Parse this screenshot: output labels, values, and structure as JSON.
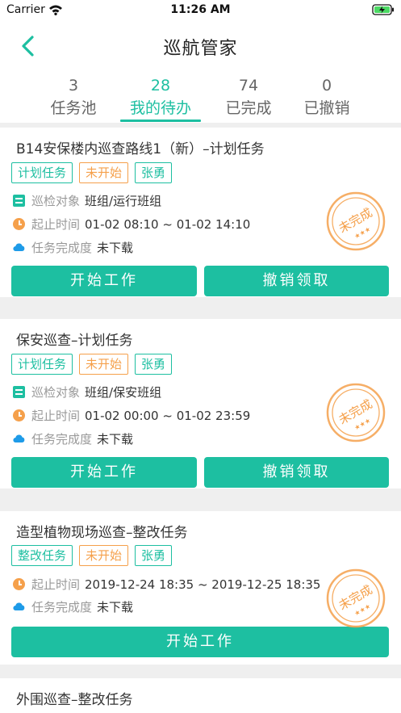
{
  "status": {
    "carrier": "Carrier",
    "time": "11:26 AM"
  },
  "nav": {
    "title": "巡航管家"
  },
  "tabs": [
    {
      "count": "3",
      "label": "任务池"
    },
    {
      "count": "28",
      "label": "我的待办"
    },
    {
      "count": "74",
      "label": "已完成"
    },
    {
      "count": "0",
      "label": "已撤销"
    }
  ],
  "labels": {
    "target": "巡检对象",
    "period": "起止时间",
    "progress": "任务完成度",
    "start": "开始工作",
    "cancel": "撤销领取",
    "stamp": "未完成",
    "stamp_stars": "★★★"
  },
  "tasks": [
    {
      "title": "B14安保楼内巡查路线1（新）–计划任务",
      "tags": [
        "计划任务",
        "未开始",
        "张勇"
      ],
      "target": "班组/运行班组",
      "period": "01-02 08:10 ~ 01-02 14:10",
      "progress": "未下载"
    },
    {
      "title": "保安巡查–计划任务",
      "tags": [
        "计划任务",
        "未开始",
        "张勇"
      ],
      "target": "班组/保安班组",
      "period": "01-02 00:00 ~ 01-02 23:59",
      "progress": "未下载"
    },
    {
      "title": "造型植物现场巡查–整改任务",
      "tags": [
        "整改任务",
        "未开始",
        "张勇"
      ],
      "period": "2019-12-24 18:35 ~ 2019-12-25 18:35",
      "progress": "未下载"
    },
    {
      "title": "外围巡查–整改任务"
    }
  ],
  "colors": {
    "accent": "#1dbfa1",
    "orange": "#f5a04b",
    "bg": "#efefef"
  }
}
